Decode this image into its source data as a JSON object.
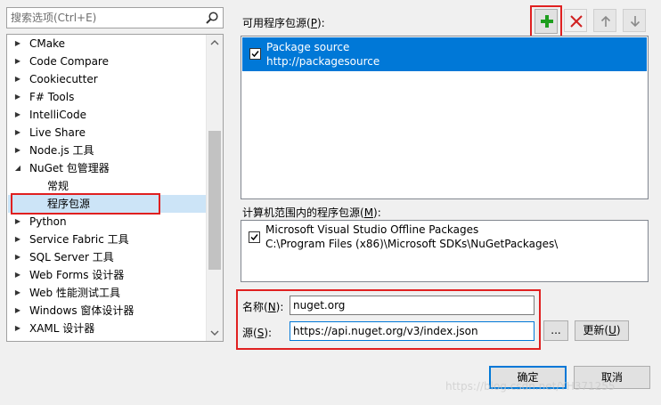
{
  "search": {
    "placeholder": "搜索选项(Ctrl+E)"
  },
  "tree": {
    "items": [
      {
        "label": "CMake",
        "level": 0,
        "arrow": "▶",
        "selected": false
      },
      {
        "label": "Code Compare",
        "level": 0,
        "arrow": "▶",
        "selected": false
      },
      {
        "label": "Cookiecutter",
        "level": 0,
        "arrow": "▶",
        "selected": false
      },
      {
        "label": "F# Tools",
        "level": 0,
        "arrow": "▶",
        "selected": false
      },
      {
        "label": "IntelliCode",
        "level": 0,
        "arrow": "▶",
        "selected": false
      },
      {
        "label": "Live Share",
        "level": 0,
        "arrow": "▶",
        "selected": false
      },
      {
        "label": "Node.js 工具",
        "level": 0,
        "arrow": "▶",
        "selected": false
      },
      {
        "label": "NuGet 包管理器",
        "level": 0,
        "arrow": "◢",
        "selected": false
      },
      {
        "label": "常规",
        "level": 1,
        "arrow": "",
        "selected": false
      },
      {
        "label": "程序包源",
        "level": 1,
        "arrow": "",
        "selected": true
      },
      {
        "label": "Python",
        "level": 0,
        "arrow": "▶",
        "selected": false
      },
      {
        "label": "Service Fabric 工具",
        "level": 0,
        "arrow": "▶",
        "selected": false
      },
      {
        "label": "SQL Server 工具",
        "level": 0,
        "arrow": "▶",
        "selected": false
      },
      {
        "label": "Web Forms 设计器",
        "level": 0,
        "arrow": "▶",
        "selected": false
      },
      {
        "label": "Web 性能测试工具",
        "level": 0,
        "arrow": "▶",
        "selected": false
      },
      {
        "label": "Windows 窗体设计器",
        "level": 0,
        "arrow": "▶",
        "selected": false
      },
      {
        "label": "XAML 设计器",
        "level": 0,
        "arrow": "▶",
        "selected": false
      }
    ]
  },
  "available_sources": {
    "label_prefix": "可用程序包源(",
    "label_key": "P",
    "label_suffix": "):",
    "items": [
      {
        "name": "Package source",
        "url": "http://packagesource",
        "checked": true,
        "selected": true
      }
    ]
  },
  "machine_sources": {
    "label_prefix": "计算机范围内的程序包源(",
    "label_key": "M",
    "label_suffix": "):",
    "items": [
      {
        "name": "Microsoft Visual Studio Offline Packages",
        "path": "C:\\Program Files (x86)\\Microsoft SDKs\\NuGetPackages\\",
        "checked": true
      }
    ]
  },
  "toolbar": {
    "add_icon": "plus-icon",
    "remove_icon": "x-icon",
    "up_icon": "arrow-up-icon",
    "down_icon": "arrow-down-icon"
  },
  "form": {
    "name_label_prefix": "名称(",
    "name_label_key": "N",
    "name_label_suffix": "):",
    "name_value": "nuget.org",
    "source_label_prefix": "源(",
    "source_label_key": "S",
    "source_label_suffix": "):",
    "source_value": "https://api.nuget.org/v3/index.json",
    "browse_label": "...",
    "update_label_prefix": "更新(",
    "update_label_key": "U",
    "update_label_suffix": ")"
  },
  "dialog": {
    "ok_label": "确定",
    "cancel_label": "取消"
  },
  "watermark": "https://blog.csdn.net/YH371255",
  "colors": {
    "selection": "#0078d7",
    "tree_selection": "#cce4f7",
    "add_green": "#1e9e1e",
    "remove_red": "#d02020",
    "highlight_outline": "#e02020"
  }
}
